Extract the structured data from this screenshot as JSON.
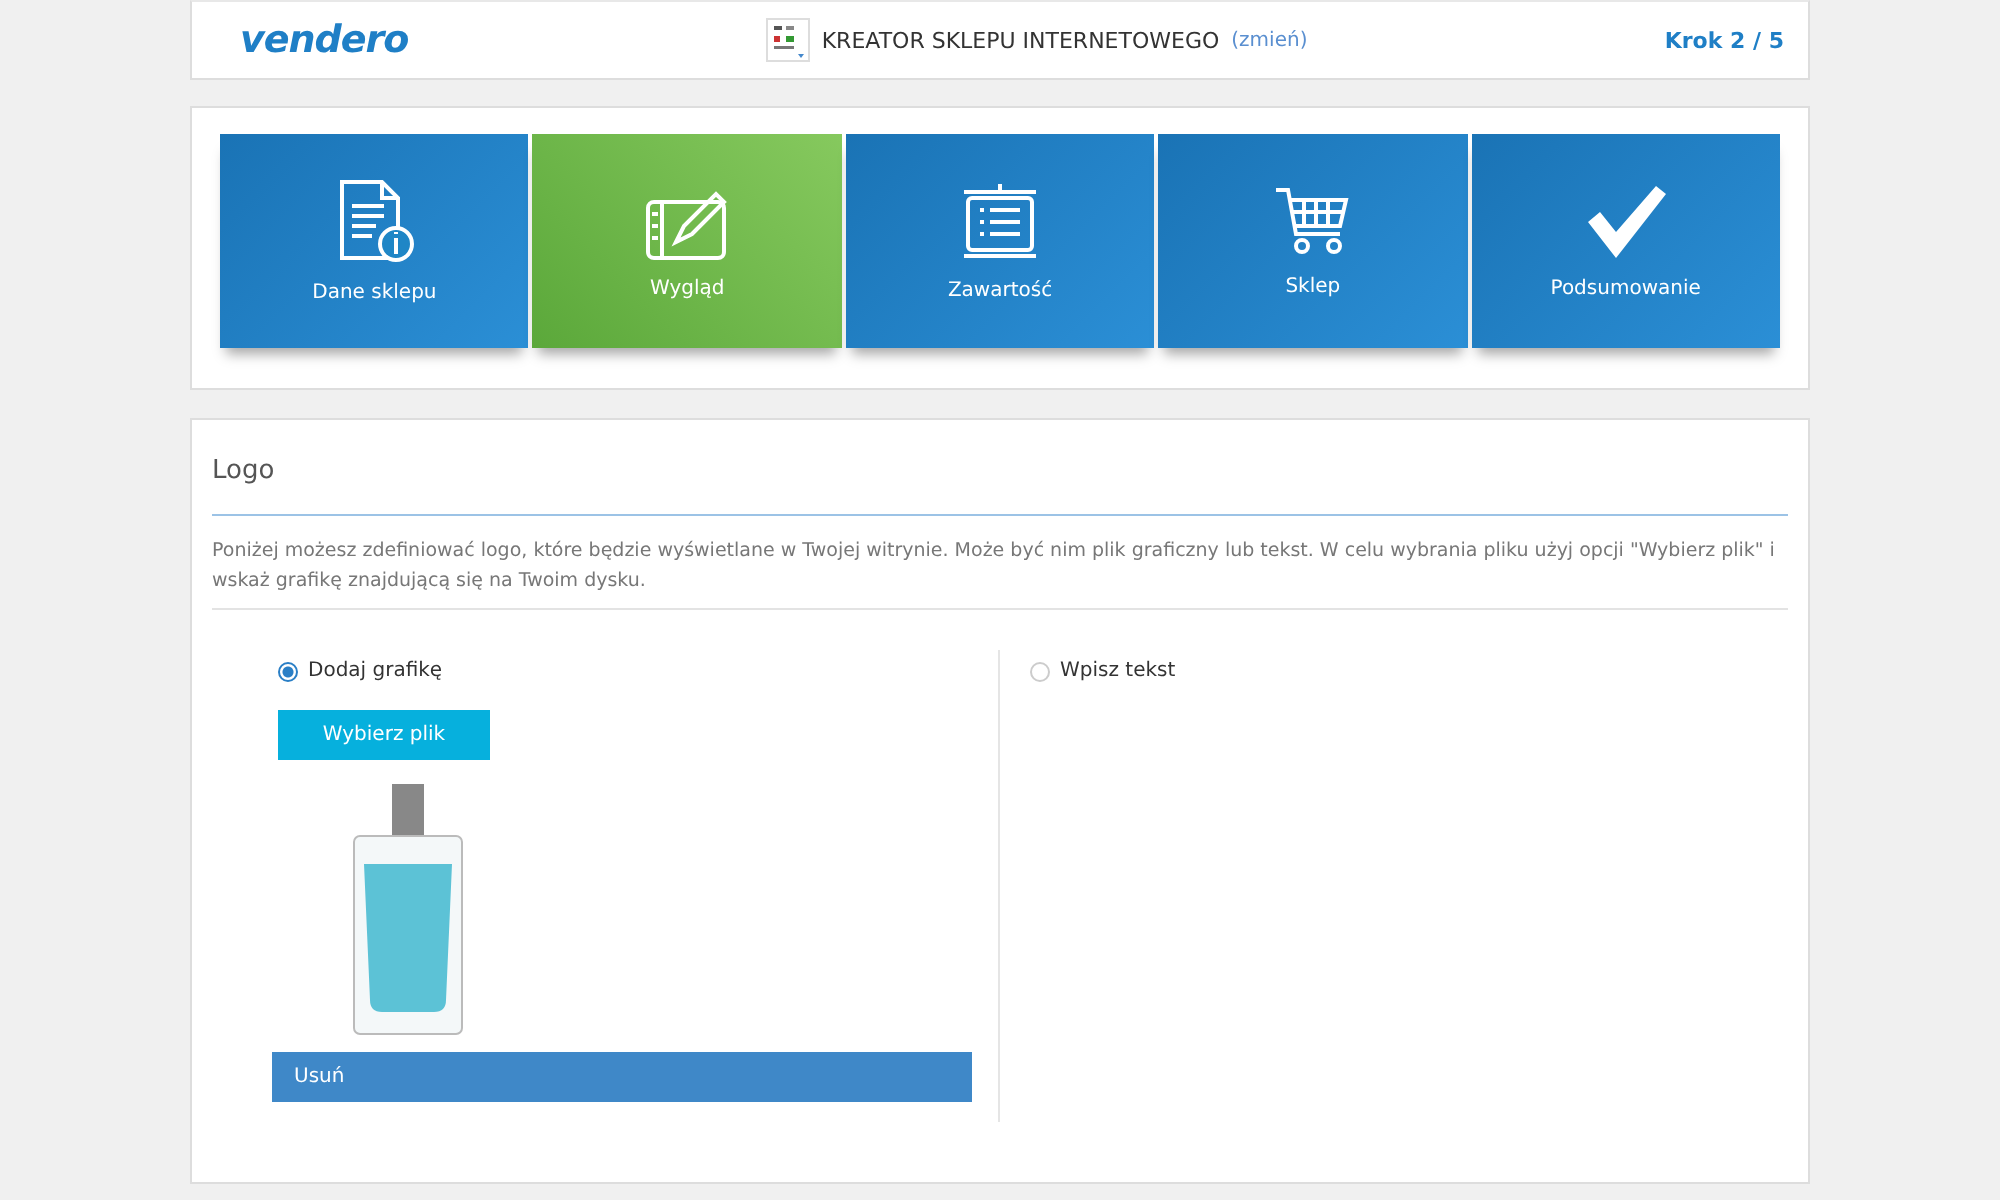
{
  "header": {
    "logo": "vendero",
    "title": "KREATOR SKLEPU INTERNETOWEGO",
    "change_link": "(zmień)",
    "step": "Krok 2 / 5"
  },
  "steps": [
    {
      "kind": "info",
      "label": "Dane sklepu",
      "selected": false
    },
    {
      "kind": "design",
      "label": "Wygląd",
      "selected": true
    },
    {
      "kind": "content",
      "label": "Zawartość",
      "selected": false
    },
    {
      "kind": "cart",
      "label": "Sklep",
      "selected": false
    },
    {
      "kind": "check",
      "label": "Podsumowanie",
      "selected": false
    }
  ],
  "section": {
    "title": "Logo",
    "description": "Poniżej możesz zdefiniować logo, które będzie wyświetlane w Twojej witrynie. Może być nim plik graficzny lub tekst. W celu wybrania pliku użyj opcji \"Wybierz plik\" i wskaż grafikę znajdującą się na Twoim dysku.",
    "options": [
      {
        "label": "Dodaj grafikę",
        "selected": true
      },
      {
        "label": "Wpisz tekst",
        "selected": false
      }
    ],
    "choose_button": "Wybierz plik",
    "remove_button": "Usuń"
  }
}
